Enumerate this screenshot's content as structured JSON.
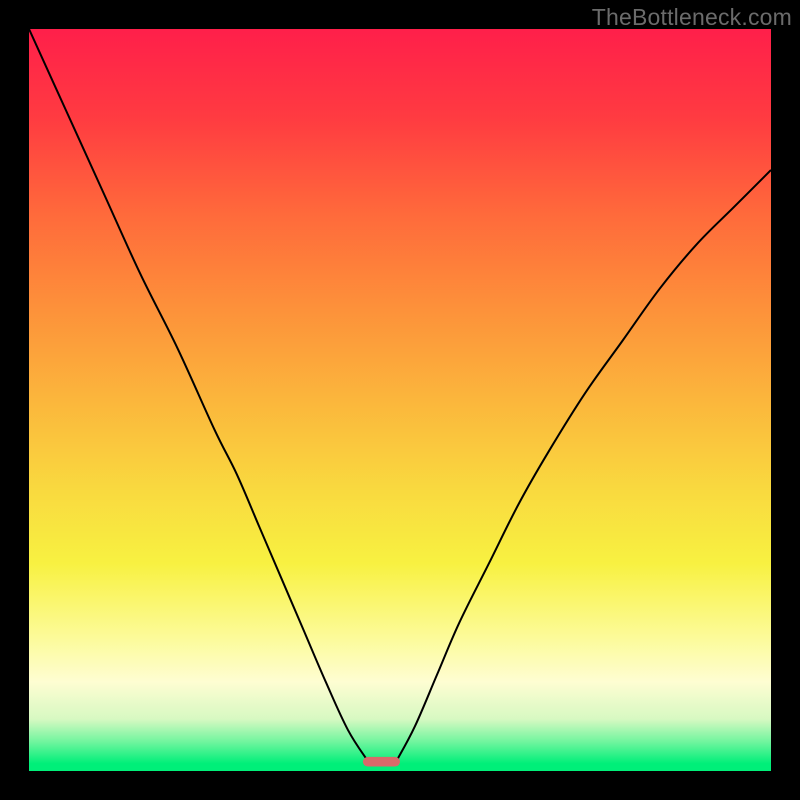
{
  "watermark": "TheBottleneck.com",
  "chart_data": {
    "type": "line",
    "title": "",
    "xlabel": "",
    "ylabel": "",
    "xlim": [
      0,
      1
    ],
    "ylim": [
      0,
      1
    ],
    "grid": false,
    "curve_left": {
      "x": [
        0.0,
        0.05,
        0.1,
        0.15,
        0.2,
        0.25,
        0.28,
        0.31,
        0.34,
        0.37,
        0.4,
        0.43,
        0.457
      ],
      "y": [
        1.0,
        0.89,
        0.78,
        0.67,
        0.57,
        0.46,
        0.4,
        0.33,
        0.26,
        0.19,
        0.12,
        0.055,
        0.013
      ]
    },
    "curve_right": {
      "x": [
        0.495,
        0.52,
        0.55,
        0.58,
        0.62,
        0.66,
        0.7,
        0.75,
        0.8,
        0.85,
        0.9,
        0.95,
        1.0
      ],
      "y": [
        0.013,
        0.06,
        0.13,
        0.2,
        0.28,
        0.36,
        0.43,
        0.51,
        0.58,
        0.65,
        0.71,
        0.76,
        0.81
      ]
    },
    "min_marker": {
      "x_center": 0.475,
      "y": 0.006,
      "width": 0.05,
      "height": 0.013
    },
    "gradient_stops": [
      {
        "offset": 0.0,
        "color": "#ff1f4a"
      },
      {
        "offset": 0.5,
        "color": "#f9d93f"
      },
      {
        "offset": 0.88,
        "color": "#fefdd2"
      },
      {
        "offset": 1.0,
        "color": "#00ef79"
      }
    ]
  }
}
